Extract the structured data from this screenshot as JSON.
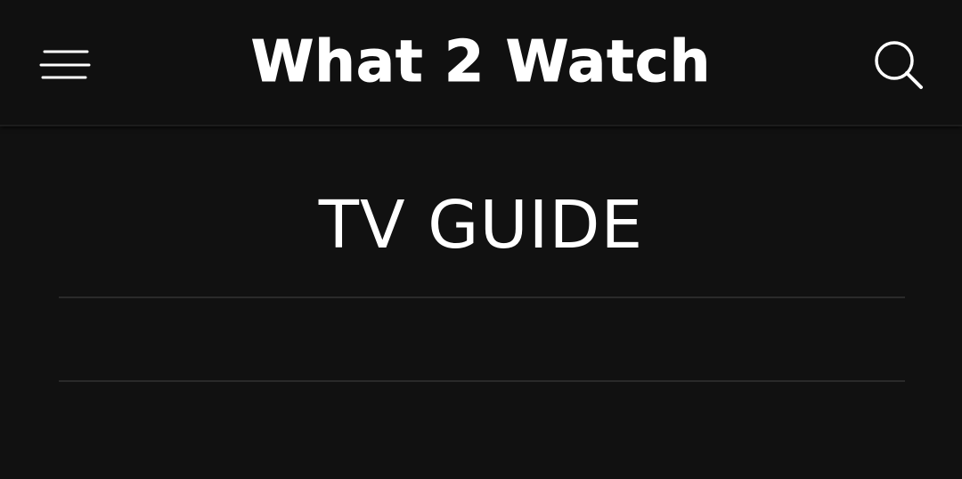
{
  "header": {
    "title": "What 2 Watch",
    "menu_icon": "hamburger-menu-icon",
    "search_icon": "search-icon"
  },
  "main": {
    "page_title": "TV GUIDE"
  },
  "colors": {
    "background": "#111111",
    "header_background": "#101010",
    "text": "#ffffff",
    "divider": "#2a2a2a"
  }
}
